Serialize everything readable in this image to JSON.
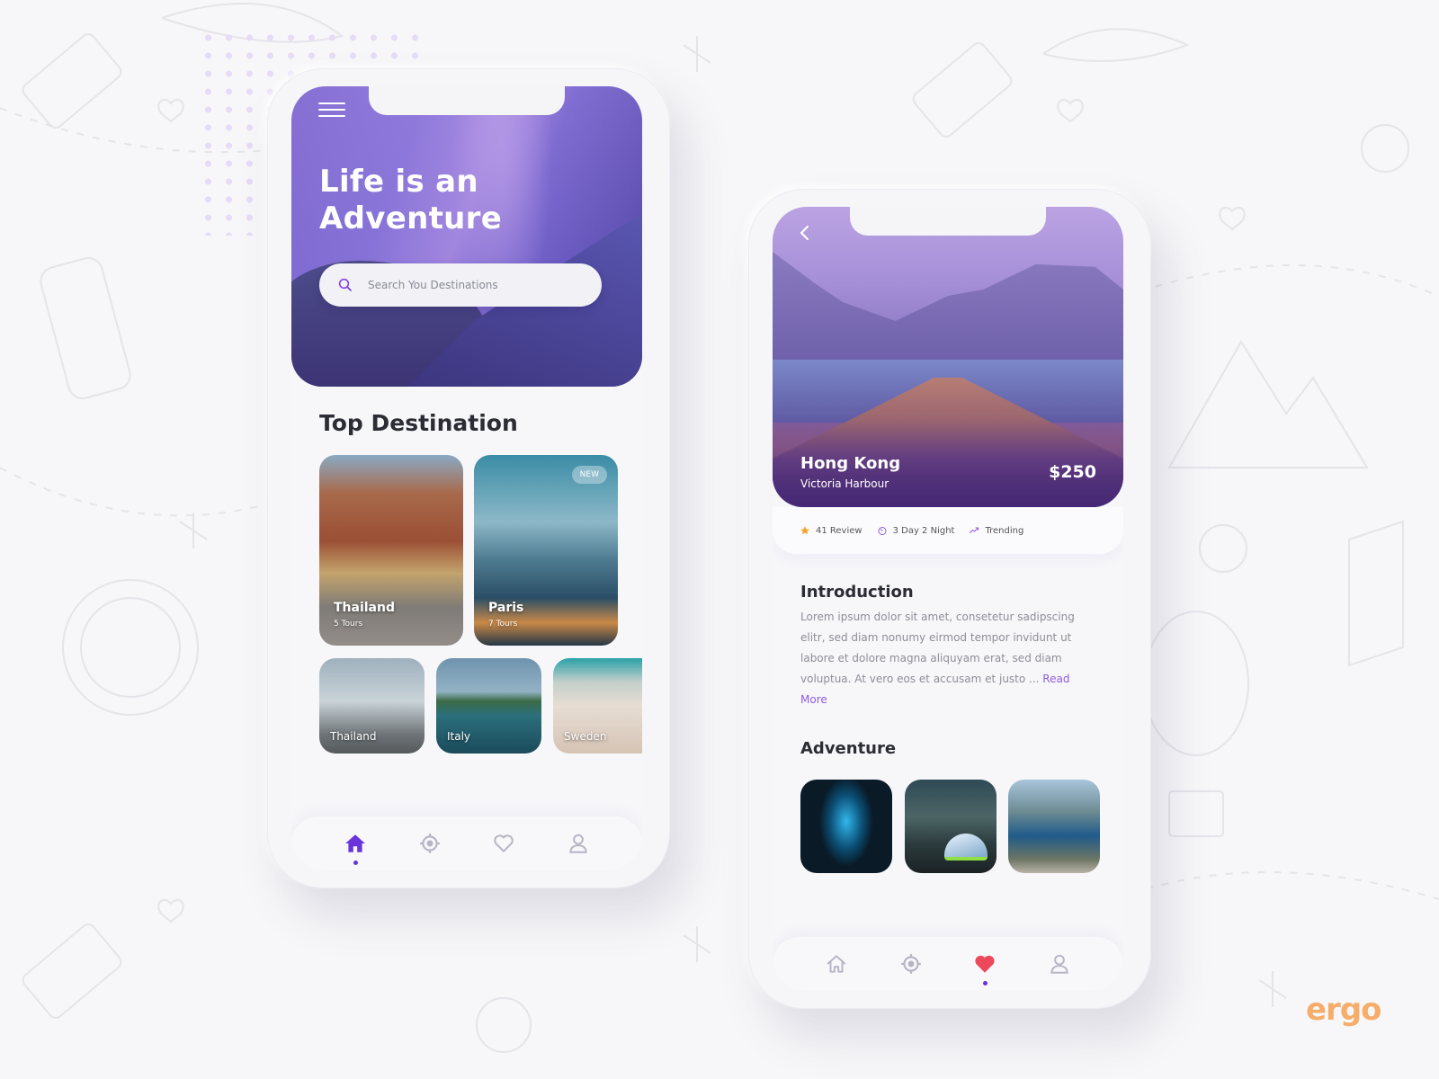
{
  "phone_home": {
    "hero": {
      "title_line1": "Life is an",
      "title_line2": "Adventure",
      "search_placeholder": "Search You Destinations"
    },
    "top_destination": {
      "title": "Top Destination",
      "featured": [
        {
          "name": "Thailand",
          "tours": "5 Tours",
          "badge": null
        },
        {
          "name": "Paris",
          "tours": "7 Tours",
          "badge": "NEW"
        }
      ],
      "more": [
        {
          "name": "Thailand"
        },
        {
          "name": "Italy"
        },
        {
          "name": "Sweden"
        }
      ]
    },
    "tabbar": {
      "active": "home",
      "items": [
        "home-icon",
        "location-icon",
        "heart-icon",
        "profile-icon"
      ]
    }
  },
  "phone_detail": {
    "hero": {
      "place": "Hong Kong",
      "subplace": "Victoria Harbour",
      "price": "$250"
    },
    "meta": {
      "reviews": "41 Review",
      "duration": "3 Day 2 Night",
      "trending": "Trending"
    },
    "introduction": {
      "title": "Introduction",
      "body": "Lorem ipsum dolor sit amet, consetetur sadipscing elitr, sed diam nonumy eirmod tempor invidunt ut labore et dolore magna aliquyam erat, sed diam voluptua. At vero eos et accusam et justo ... ",
      "read_more": "Read More"
    },
    "adventure": {
      "title": "Adventure",
      "images": [
        "cave-diving",
        "night-camping",
        "fjord-hiking"
      ]
    },
    "tabbar": {
      "active": "favorites",
      "items": [
        "home-icon",
        "location-icon",
        "heart-icon",
        "profile-icon"
      ]
    }
  },
  "branding": {
    "logo": "ergo"
  },
  "colors": {
    "accent": "#6a34dc",
    "heart_active": "#ec4a5a",
    "star": "#f4a52a",
    "link": "#8e5ce0",
    "logo": "#f6ad6a"
  }
}
